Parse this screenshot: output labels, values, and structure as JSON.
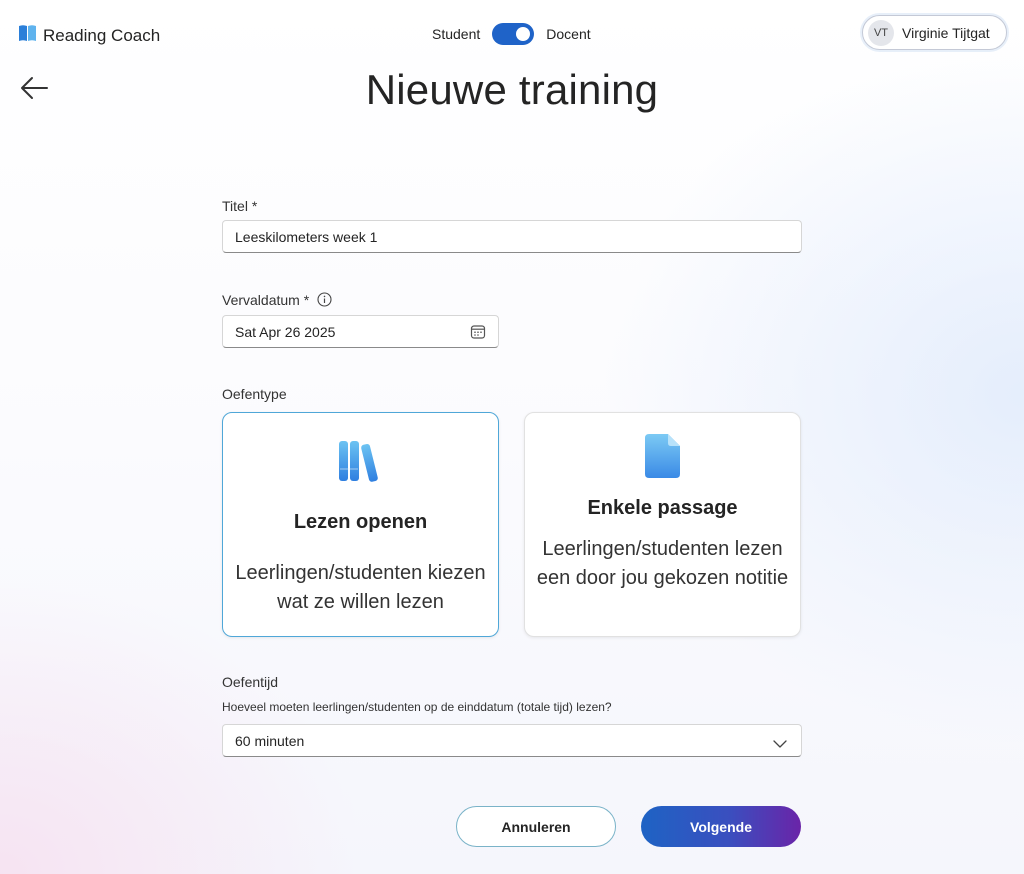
{
  "header": {
    "app_name": "Reading Coach",
    "mode_left": "Student",
    "mode_right": "Docent",
    "mode_active": "Docent",
    "user_initials": "VT",
    "user_name": "Virginie Tijtgat"
  },
  "page": {
    "title": "Nieuwe training"
  },
  "form": {
    "title_label": "Titel *",
    "title_value": "Leeskilometers week 1",
    "due_label": "Vervaldatum *",
    "due_value": "Sat Apr 26 2025",
    "type_label": "Oefentype",
    "types": [
      {
        "title": "Lezen openen",
        "description": "Leerlingen/studenten kiezen wat ze willen lezen",
        "selected": true,
        "icon": "books-icon"
      },
      {
        "title": "Enkele passage",
        "description": "Leerlingen/studenten lezen een door jou gekozen notitie",
        "selected": false,
        "icon": "document-icon"
      }
    ],
    "time_label": "Oefentijd",
    "time_hint": "Hoeveel moeten leerlingen/studenten op de einddatum (totale tijd) lezen?",
    "time_value": "60 minuten"
  },
  "actions": {
    "cancel": "Annuleren",
    "next": "Volgende"
  },
  "colors": {
    "accent": "#1f63c8",
    "selected_border": "#4fa7d8",
    "gradient_end": "#6a24a8"
  }
}
